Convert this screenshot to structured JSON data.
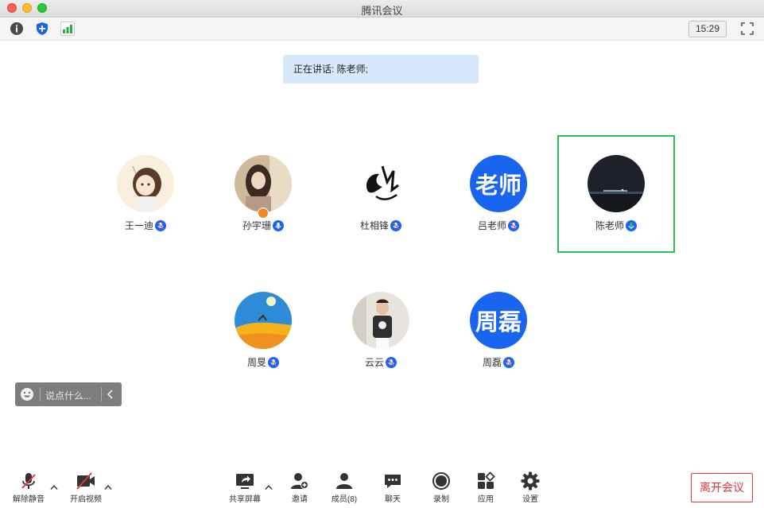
{
  "window": {
    "title": "腾讯会议"
  },
  "toolbar": {
    "time": "15:29",
    "icons": [
      "info-icon",
      "shield-icon",
      "signal-icon",
      "fullscreen-icon"
    ]
  },
  "speaking": {
    "text": "正在讲话: 陈老师;"
  },
  "participants": [
    {
      "name": "王一迪",
      "avatar": "photo-cartoon-girl",
      "mic": "muted"
    },
    {
      "name": "孙宇珊",
      "avatar": "photo-girl",
      "mic": "unmuted",
      "host": true
    },
    {
      "name": "杜相锋",
      "avatar": "photo-dragon-ink",
      "mic": "muted"
    },
    {
      "name": "吕老师",
      "avatar_text": "老师",
      "mic": "muted"
    },
    {
      "name": "陈老师",
      "avatar": "photo-night-city",
      "mic": "speaking",
      "active": true
    },
    {
      "name": "周旻",
      "avatar": "photo-sunset",
      "mic": "muted"
    },
    {
      "name": "云云",
      "avatar": "photo-child",
      "mic": "muted"
    },
    {
      "name": "周磊",
      "avatar_text": "周磊",
      "mic": "muted"
    }
  ],
  "chat": {
    "placeholder": "说点什么..."
  },
  "bottom_bar": {
    "unmute_label": "解除静音",
    "video_label": "开启视频",
    "share_label": "共享屏幕",
    "invite_label": "邀请",
    "members_label": "成员(8)",
    "chat_label": "聊天",
    "record_label": "录制",
    "apps_label": "应用",
    "settings_label": "设置",
    "leave_label": "离开会议"
  },
  "colors": {
    "accent": "#1a64f2",
    "active_border": "#2ebd59",
    "leave": "#e0343e",
    "speaking_bg": "#d8e8fb"
  }
}
